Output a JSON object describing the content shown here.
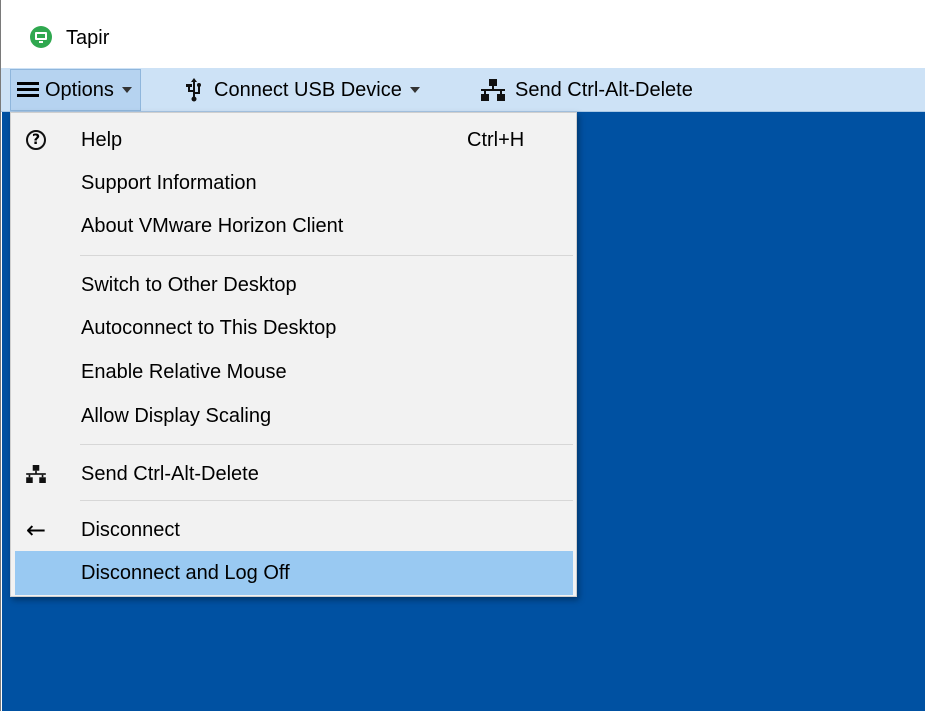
{
  "window": {
    "title": "Tapir"
  },
  "toolbar": {
    "options_label": "Options",
    "usb_label": "Connect USB Device",
    "cad_label": "Send Ctrl-Alt-Delete"
  },
  "menu": {
    "items": [
      {
        "label": "Help",
        "shortcut": "Ctrl+H",
        "icon": "help-circle-icon"
      },
      {
        "label": "Support Information"
      },
      {
        "label": "About VMware Horizon Client"
      },
      {
        "label": "Switch to Other Desktop"
      },
      {
        "label": "Autoconnect to This Desktop"
      },
      {
        "label": "Enable Relative Mouse"
      },
      {
        "label": "Allow Display Scaling"
      },
      {
        "label": "Send Ctrl-Alt-Delete",
        "icon": "network-icon"
      },
      {
        "label": "Disconnect",
        "icon": "arrow-left-icon"
      },
      {
        "label": "Disconnect and Log Off",
        "highlighted": true
      }
    ]
  },
  "colors": {
    "toolbar_bg": "#cde2f6",
    "desktop_bg": "#0051a2",
    "menu_bg": "#f2f2f2",
    "menu_highlight": "#99c9f2",
    "app_icon": "#2fa84f"
  }
}
